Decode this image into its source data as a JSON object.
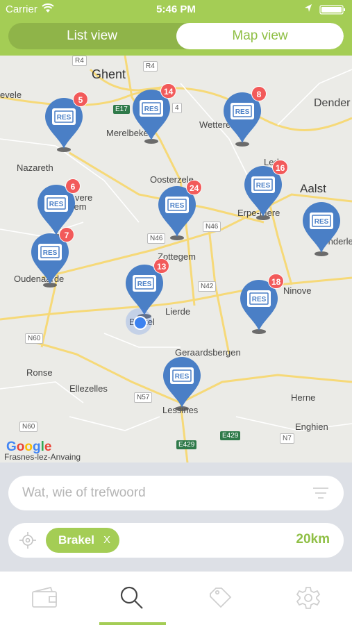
{
  "status": {
    "carrier": "Carrier",
    "time": "5:46 PM"
  },
  "view_toggle": {
    "list_label": "List view",
    "map_label": "Map view",
    "selected": "Map view"
  },
  "map": {
    "places": [
      "Ghent",
      "Merelbeke",
      "Wetteren",
      "Dender",
      "Nazareth",
      "Oosterzele",
      "Aalst",
      "vere",
      "ngem",
      "Erpe-Mere",
      "Denderleeu",
      "Oudenaarde",
      "Zottegem",
      "Lierde",
      "Ninove",
      "Brakel",
      "Geraardsbergen",
      "Ronse",
      "Ellezelles",
      "Herne",
      "Lessines",
      "Enghien",
      "Frasnes-lez-Anvaing",
      "evele",
      "Lede"
    ],
    "road_labels": [
      "R4",
      "E17",
      "N46",
      "N46",
      "N42",
      "N60",
      "N57",
      "N60",
      "E429",
      "E429",
      "N7",
      "R4",
      "4"
    ],
    "pins": [
      {
        "brand": "RES",
        "count": "5"
      },
      {
        "brand": "RES",
        "count": "14"
      },
      {
        "brand": "RES",
        "count": "8"
      },
      {
        "brand": "RES",
        "count": "6"
      },
      {
        "brand": "RES",
        "count": "24"
      },
      {
        "brand": "RES",
        "count": "16"
      },
      {
        "brand": "RES",
        "count": "7"
      },
      {
        "brand": "RES",
        "count": ""
      },
      {
        "brand": "RES",
        "count": "13"
      },
      {
        "brand": "RES",
        "count": "18"
      },
      {
        "brand": "RES",
        "count": ""
      }
    ],
    "attribution": "Google"
  },
  "search": {
    "placeholder": "Wat, wie of trefwoord",
    "value": ""
  },
  "location": {
    "chip_label": "Brakel",
    "chip_clear": "X",
    "radius": "20km"
  },
  "tabs": [
    {
      "icon": "wallet-icon",
      "active": false
    },
    {
      "icon": "search-icon",
      "active": true
    },
    {
      "icon": "tag-icon",
      "active": false
    },
    {
      "icon": "gear-icon",
      "active": false
    }
  ],
  "colors": {
    "accent": "#a4cd55",
    "pin": "#4a7fc6",
    "badge": "#f25a5a"
  }
}
